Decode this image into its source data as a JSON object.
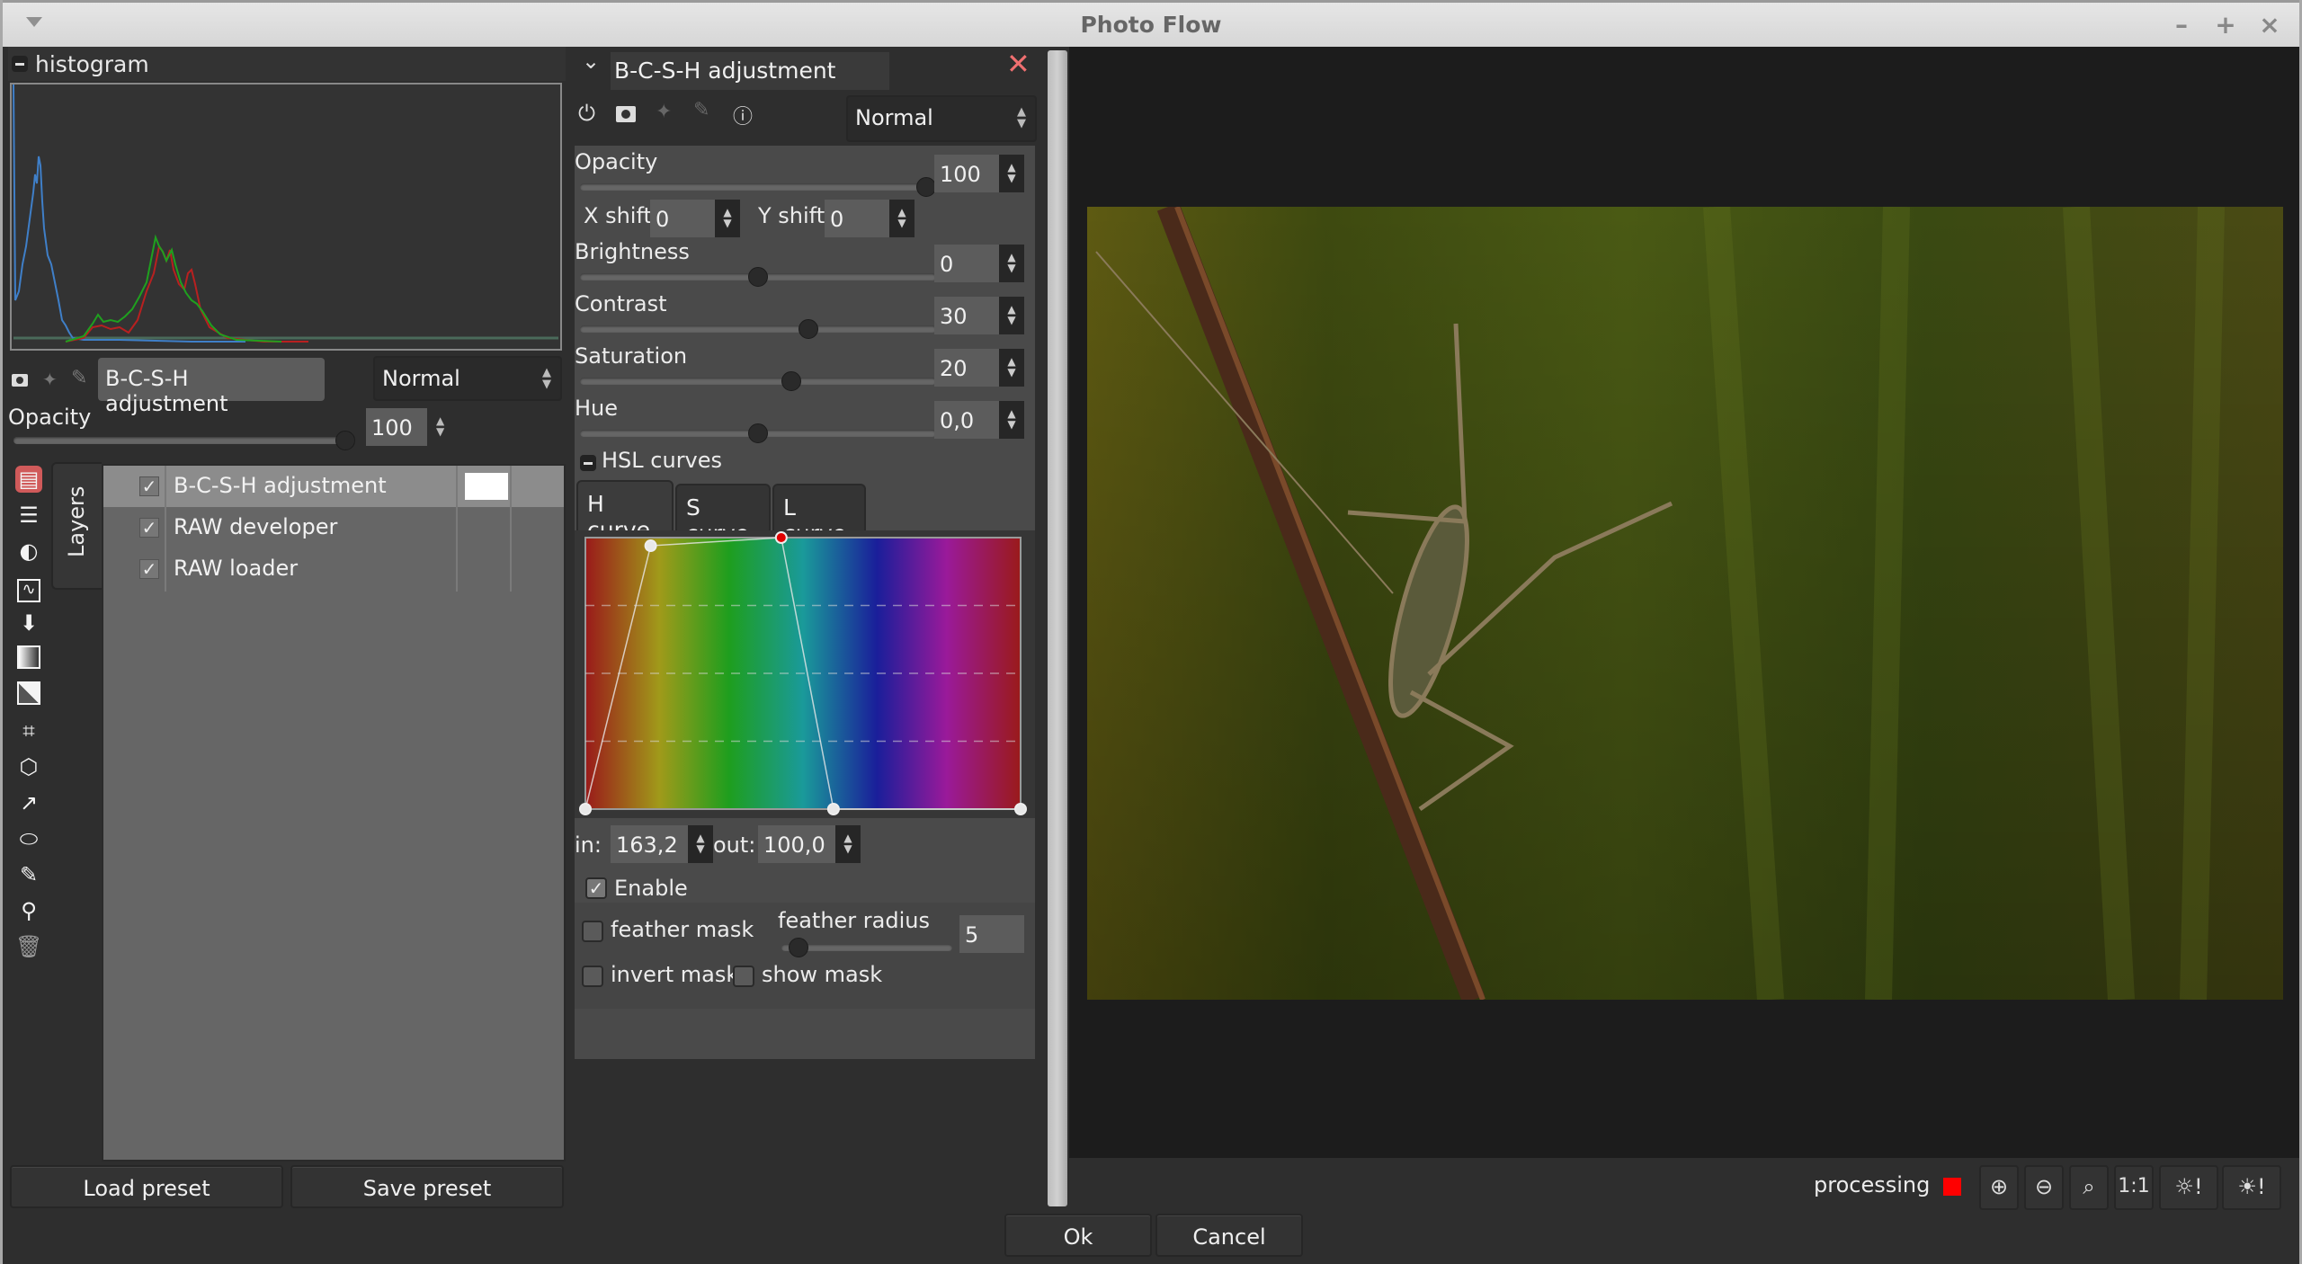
{
  "window": {
    "title": "Photo Flow",
    "controls": {
      "minimize": "–",
      "maximize": "+",
      "close": "×"
    }
  },
  "histogram": {
    "label": "histogram",
    "colors": {
      "blue": "#3f7fc8",
      "green": "#1fa01f",
      "red": "#b82020"
    }
  },
  "layer_controls": {
    "layer_name": "B-C-S-H adjustment",
    "blend_mode": "Normal",
    "opacity_label": "Opacity",
    "opacity_value": "100",
    "opacity_fraction": 1.0
  },
  "layers_tab": {
    "label": "Layers"
  },
  "layers": [
    {
      "name": "B-C-S-H adjustment",
      "checked": true,
      "selected": true
    },
    {
      "name": "RAW developer",
      "checked": true,
      "selected": false
    },
    {
      "name": "RAW loader",
      "checked": true,
      "selected": false
    }
  ],
  "left_buttons": {
    "load_preset": "Load preset",
    "save_preset": "Save preset"
  },
  "tool_icons": [
    "layers-icon",
    "group-icon",
    "contrast-icon",
    "curves-icon",
    "paint-bucket-icon",
    "gradient-icon",
    "tone-icon",
    "crop-icon",
    "perspective-icon",
    "scale-icon",
    "ellipse-mask-icon",
    "draw-icon",
    "clone-stamp-icon",
    "trash-icon"
  ],
  "module": {
    "title": "B-C-S-H adjustment",
    "blend_mode": "Normal",
    "opacity": {
      "label": "Opacity",
      "value": "100",
      "fraction": 1.0
    },
    "xshift": {
      "label": "X shift",
      "value": "0"
    },
    "yshift": {
      "label": "Y shift",
      "value": "0"
    },
    "brightness": {
      "label": "Brightness",
      "value": "0",
      "fraction": 0.5
    },
    "contrast": {
      "label": "Contrast",
      "value": "30",
      "fraction": 0.65
    },
    "saturation": {
      "label": "Saturation",
      "value": "20",
      "fraction": 0.6
    },
    "hue": {
      "label": "Hue",
      "value": "0,0",
      "fraction": 0.5
    },
    "hsl_curves_label": "HSL curves",
    "tabs": [
      {
        "label": "H curve",
        "active": true
      },
      {
        "label": "S curve",
        "active": false
      },
      {
        "label": "L curve",
        "active": false
      }
    ],
    "curve_points": [
      [
        0,
        0
      ],
      [
        0.15,
        0.97
      ],
      [
        0.45,
        1.0
      ],
      [
        0.57,
        0.0
      ],
      [
        1.0,
        0.0
      ]
    ],
    "selected_point_index": 2,
    "in_label": "in:",
    "in_value": "163,2",
    "out_label": "out:",
    "out_value": "100,0",
    "enable_label": "Enable",
    "enable_checked": true,
    "feather_mask_label": "feather mask",
    "feather_radius_label": "feather radius",
    "feather_radius_value": "5",
    "feather_radius_fraction": 0.05,
    "invert_mask_label": "invert mask",
    "show_mask_label": "show mask"
  },
  "status": {
    "processing_label": "processing",
    "processing_color": "#ff0000",
    "zoom_11_label": "1:1"
  },
  "dialog_buttons": {
    "ok": "Ok",
    "cancel": "Cancel"
  },
  "accent": {
    "close_red": "#ef6f70",
    "selected_tool_bg": "#d05a5a"
  }
}
